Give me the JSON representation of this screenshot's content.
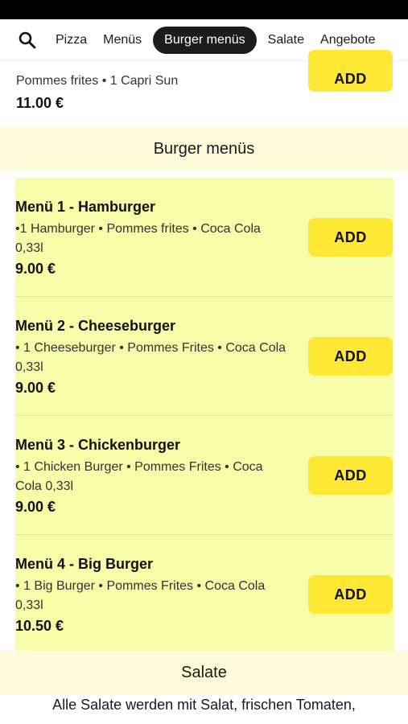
{
  "nav": {
    "search_icon": "search-icon",
    "tabs": [
      {
        "label": "Pizza"
      },
      {
        "label": "Menüs"
      },
      {
        "label": "Burger menüs"
      },
      {
        "label": "Salate"
      },
      {
        "label": "Angebote"
      }
    ]
  },
  "previous_item": {
    "desc": "Pommes frites • 1 Capri Sun",
    "price": "11.00 €",
    "add_label": "ADD"
  },
  "burger_section": {
    "title": "Burger menüs",
    "items": [
      {
        "title": "Menü 1 - Hamburger",
        "desc": "•1 Hamburger • Pommes frites • Coca Cola 0,33l",
        "price": "9.00 €",
        "add_label": "ADD"
      },
      {
        "title": "Menü 2 - Cheeseburger",
        "desc": "• 1 Cheeseburger • Pommes Frites • Coca Cola 0,33l",
        "price": "9.00 €",
        "add_label": "ADD"
      },
      {
        "title": "Menü 3 - Chickenburger",
        "desc": "• 1 Chicken Burger • Pommes Frites • Coca Cola 0,33l",
        "price": "9.00 €",
        "add_label": "ADD"
      },
      {
        "title": "Menü 4 - Big Burger",
        "desc": "• 1 Big Burger • Pommes Frites • Coca Cola 0,33l",
        "price": "10.50 €",
        "add_label": "ADD"
      }
    ]
  },
  "salate_section": {
    "title": "Salate",
    "desc": "Alle Salate werden mit Salat, frischen Tomaten,"
  },
  "colors": {
    "accent_button": "#ffe736",
    "highlight_bg": "#f7fca8",
    "section_header_bg": "#fbfad9",
    "active_tab_bg": "#1c1c1c"
  }
}
